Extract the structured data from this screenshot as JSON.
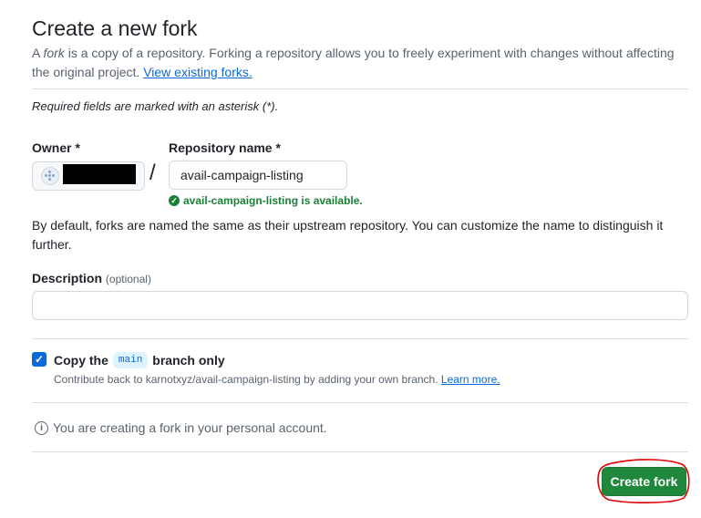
{
  "header": {
    "title": "Create a new fork",
    "intro_prefix": "A ",
    "intro_em": "fork",
    "intro_suffix": " is a copy of a repository. Forking a repository allows you to freely experiment with changes without affecting the original project. ",
    "view_forks_link": "View existing forks."
  },
  "form": {
    "required_note": "Required fields are marked with an asterisk (*).",
    "owner_label": "Owner *",
    "repo_label": "Repository name *",
    "repo_value": "avail-campaign-listing",
    "availability": "avail-campaign-listing is available.",
    "naming_note": "By default, forks are named the same as their upstream repository. You can customize the name to distinguish it further.",
    "description_label": "Description",
    "description_optional": "(optional)",
    "description_value": "",
    "copy_prefix": "Copy the",
    "copy_branch": "main",
    "copy_suffix": "branch only",
    "copy_checked": true,
    "copy_help": "Contribute back to karnotxyz/avail-campaign-listing by adding your own branch.",
    "learn_more": "Learn more.",
    "info_text": "You are creating a fork in your personal account.",
    "submit_label": "Create fork"
  },
  "colors": {
    "primary_button": "#1f883d",
    "link": "#0969da",
    "success": "#1a7f37",
    "annotation_circle": "#e00000"
  },
  "icons": {
    "availability": "check-circle-icon",
    "info": "info-icon",
    "checkbox": "checkmark-icon"
  }
}
